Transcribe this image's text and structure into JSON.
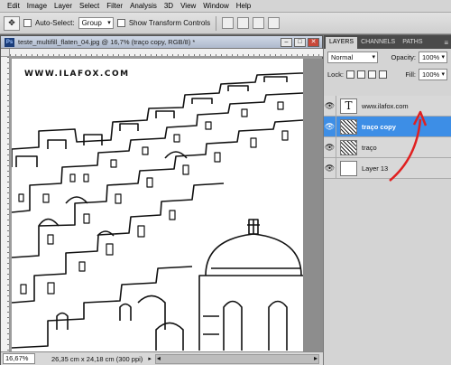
{
  "menu": [
    "Edit",
    "Image",
    "Layer",
    "Select",
    "Filter",
    "Analysis",
    "3D",
    "View",
    "Window",
    "Help"
  ],
  "options": {
    "auto_select_label": "Auto-Select:",
    "auto_select_value": "Group",
    "show_transform_label": "Show Transform Controls"
  },
  "document": {
    "title": "teste_multifill_flaten_04.jpg @ 16,7% (traço copy, RGB/8) *",
    "watermark": "WWW.ILAFOX.COM",
    "zoom": "16,67%",
    "info": "26,35 cm x 24,18 cm (300 ppi)"
  },
  "panel": {
    "tabs": [
      "LAYERS",
      "CHANNELS",
      "PATHS"
    ],
    "blend_mode": "Normal",
    "opacity_label": "Opacity:",
    "opacity_value": "100%",
    "lock_label": "Lock:",
    "fill_label": "Fill:",
    "fill_value": "100%",
    "layers": [
      {
        "name": "www.ilafox.com",
        "thumb": "T",
        "selected": false
      },
      {
        "name": "traço copy",
        "thumb": "",
        "selected": true
      },
      {
        "name": "traço",
        "thumb": "",
        "selected": false
      },
      {
        "name": "Layer 13",
        "thumb": "",
        "selected": false
      }
    ]
  },
  "colors": {
    "selected_layer": "#3d8ee6",
    "annotation_arrow": "#e02020"
  }
}
